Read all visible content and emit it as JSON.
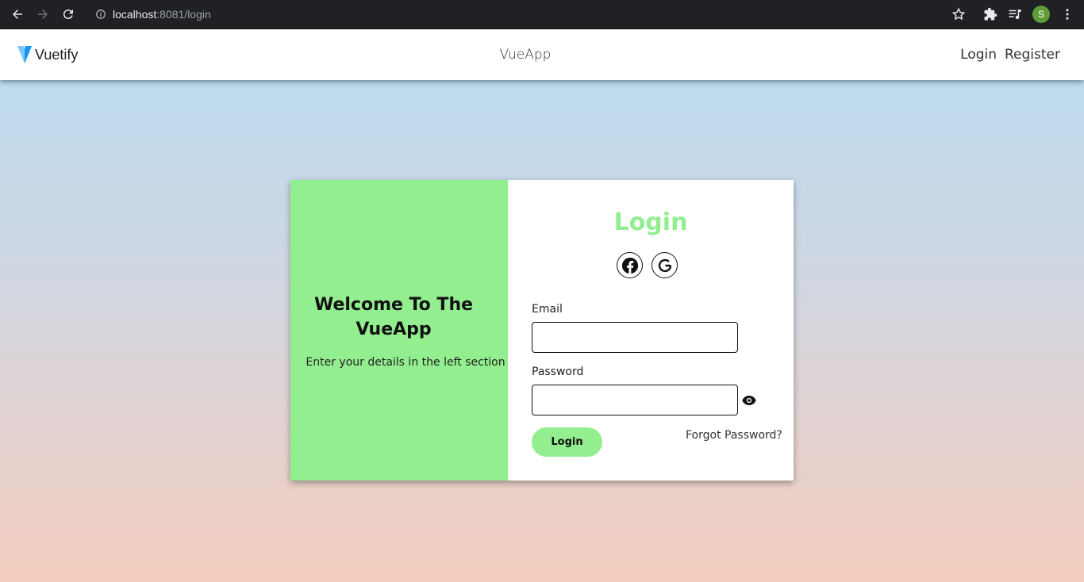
{
  "browser": {
    "url_host": "localhost",
    "url_path": ":8081/login",
    "profile_initial": "S"
  },
  "app_bar": {
    "brand_name": "Vuetify",
    "title": "VueApp",
    "nav": [
      "Login",
      "Register"
    ]
  },
  "welcome": {
    "title": "Welcome To The VueApp",
    "subtitle": "Enter your details in the left section"
  },
  "login_form": {
    "heading": "Login",
    "social": [
      "facebook-icon",
      "google-icon"
    ],
    "email_label": "Email",
    "email_value": "",
    "password_label": "Password",
    "password_value": "",
    "submit_label": "Login",
    "forgot_label": "Forgot Password?"
  },
  "colors": {
    "accent": "#93ee8f",
    "vuetify_logo_light": "#7bc6ff",
    "vuetify_logo_dark": "#1697f6"
  }
}
